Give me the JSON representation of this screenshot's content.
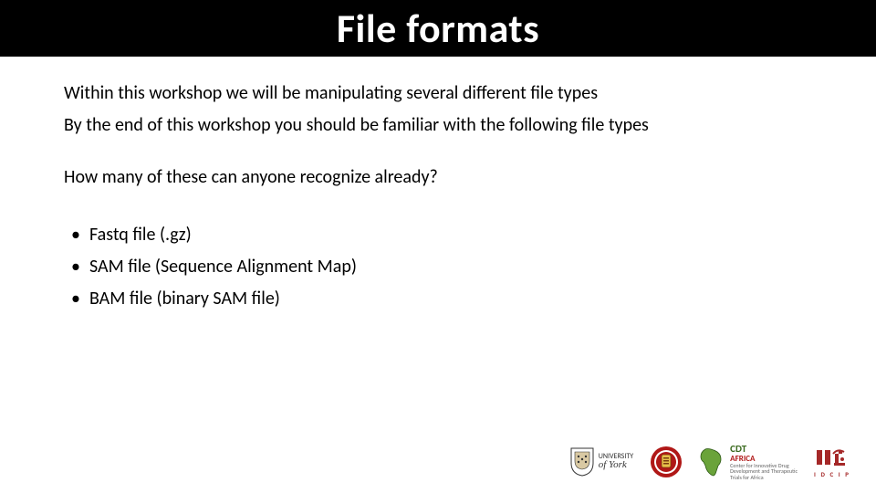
{
  "title": "File formats",
  "paragraphs": {
    "p1": "Within this workshop we will be manipulating several different file types",
    "p2": "By the end of this workshop you should be familiar with the following file types",
    "p3": "How many of these can anyone recognize already?"
  },
  "bullets": [
    "Fastq file (.gz)",
    "SAM file (Sequence Alignment Map)",
    "BAM file (binary SAM file)"
  ],
  "logos": {
    "york": {
      "name": "UNIVERSITY",
      "sub": "of York"
    },
    "cdt": {
      "name": "CDT",
      "sub": "AFRICA"
    },
    "idcip": {
      "name": "I D C I P"
    }
  }
}
